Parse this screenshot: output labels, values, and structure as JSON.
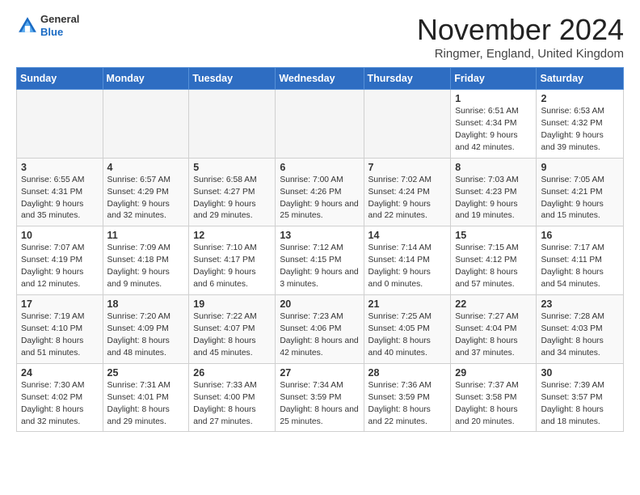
{
  "header": {
    "logo_general": "General",
    "logo_blue": "Blue",
    "month_title": "November 2024",
    "location": "Ringmer, England, United Kingdom"
  },
  "weekdays": [
    "Sunday",
    "Monday",
    "Tuesday",
    "Wednesday",
    "Thursday",
    "Friday",
    "Saturday"
  ],
  "weeks": [
    [
      {
        "day": "",
        "info": ""
      },
      {
        "day": "",
        "info": ""
      },
      {
        "day": "",
        "info": ""
      },
      {
        "day": "",
        "info": ""
      },
      {
        "day": "",
        "info": ""
      },
      {
        "day": "1",
        "info": "Sunrise: 6:51 AM\nSunset: 4:34 PM\nDaylight: 9 hours and 42 minutes."
      },
      {
        "day": "2",
        "info": "Sunrise: 6:53 AM\nSunset: 4:32 PM\nDaylight: 9 hours and 39 minutes."
      }
    ],
    [
      {
        "day": "3",
        "info": "Sunrise: 6:55 AM\nSunset: 4:31 PM\nDaylight: 9 hours and 35 minutes."
      },
      {
        "day": "4",
        "info": "Sunrise: 6:57 AM\nSunset: 4:29 PM\nDaylight: 9 hours and 32 minutes."
      },
      {
        "day": "5",
        "info": "Sunrise: 6:58 AM\nSunset: 4:27 PM\nDaylight: 9 hours and 29 minutes."
      },
      {
        "day": "6",
        "info": "Sunrise: 7:00 AM\nSunset: 4:26 PM\nDaylight: 9 hours and 25 minutes."
      },
      {
        "day": "7",
        "info": "Sunrise: 7:02 AM\nSunset: 4:24 PM\nDaylight: 9 hours and 22 minutes."
      },
      {
        "day": "8",
        "info": "Sunrise: 7:03 AM\nSunset: 4:23 PM\nDaylight: 9 hours and 19 minutes."
      },
      {
        "day": "9",
        "info": "Sunrise: 7:05 AM\nSunset: 4:21 PM\nDaylight: 9 hours and 15 minutes."
      }
    ],
    [
      {
        "day": "10",
        "info": "Sunrise: 7:07 AM\nSunset: 4:19 PM\nDaylight: 9 hours and 12 minutes."
      },
      {
        "day": "11",
        "info": "Sunrise: 7:09 AM\nSunset: 4:18 PM\nDaylight: 9 hours and 9 minutes."
      },
      {
        "day": "12",
        "info": "Sunrise: 7:10 AM\nSunset: 4:17 PM\nDaylight: 9 hours and 6 minutes."
      },
      {
        "day": "13",
        "info": "Sunrise: 7:12 AM\nSunset: 4:15 PM\nDaylight: 9 hours and 3 minutes."
      },
      {
        "day": "14",
        "info": "Sunrise: 7:14 AM\nSunset: 4:14 PM\nDaylight: 9 hours and 0 minutes."
      },
      {
        "day": "15",
        "info": "Sunrise: 7:15 AM\nSunset: 4:12 PM\nDaylight: 8 hours and 57 minutes."
      },
      {
        "day": "16",
        "info": "Sunrise: 7:17 AM\nSunset: 4:11 PM\nDaylight: 8 hours and 54 minutes."
      }
    ],
    [
      {
        "day": "17",
        "info": "Sunrise: 7:19 AM\nSunset: 4:10 PM\nDaylight: 8 hours and 51 minutes."
      },
      {
        "day": "18",
        "info": "Sunrise: 7:20 AM\nSunset: 4:09 PM\nDaylight: 8 hours and 48 minutes."
      },
      {
        "day": "19",
        "info": "Sunrise: 7:22 AM\nSunset: 4:07 PM\nDaylight: 8 hours and 45 minutes."
      },
      {
        "day": "20",
        "info": "Sunrise: 7:23 AM\nSunset: 4:06 PM\nDaylight: 8 hours and 42 minutes."
      },
      {
        "day": "21",
        "info": "Sunrise: 7:25 AM\nSunset: 4:05 PM\nDaylight: 8 hours and 40 minutes."
      },
      {
        "day": "22",
        "info": "Sunrise: 7:27 AM\nSunset: 4:04 PM\nDaylight: 8 hours and 37 minutes."
      },
      {
        "day": "23",
        "info": "Sunrise: 7:28 AM\nSunset: 4:03 PM\nDaylight: 8 hours and 34 minutes."
      }
    ],
    [
      {
        "day": "24",
        "info": "Sunrise: 7:30 AM\nSunset: 4:02 PM\nDaylight: 8 hours and 32 minutes."
      },
      {
        "day": "25",
        "info": "Sunrise: 7:31 AM\nSunset: 4:01 PM\nDaylight: 8 hours and 29 minutes."
      },
      {
        "day": "26",
        "info": "Sunrise: 7:33 AM\nSunset: 4:00 PM\nDaylight: 8 hours and 27 minutes."
      },
      {
        "day": "27",
        "info": "Sunrise: 7:34 AM\nSunset: 3:59 PM\nDaylight: 8 hours and 25 minutes."
      },
      {
        "day": "28",
        "info": "Sunrise: 7:36 AM\nSunset: 3:59 PM\nDaylight: 8 hours and 22 minutes."
      },
      {
        "day": "29",
        "info": "Sunrise: 7:37 AM\nSunset: 3:58 PM\nDaylight: 8 hours and 20 minutes."
      },
      {
        "day": "30",
        "info": "Sunrise: 7:39 AM\nSunset: 3:57 PM\nDaylight: 8 hours and 18 minutes."
      }
    ]
  ]
}
